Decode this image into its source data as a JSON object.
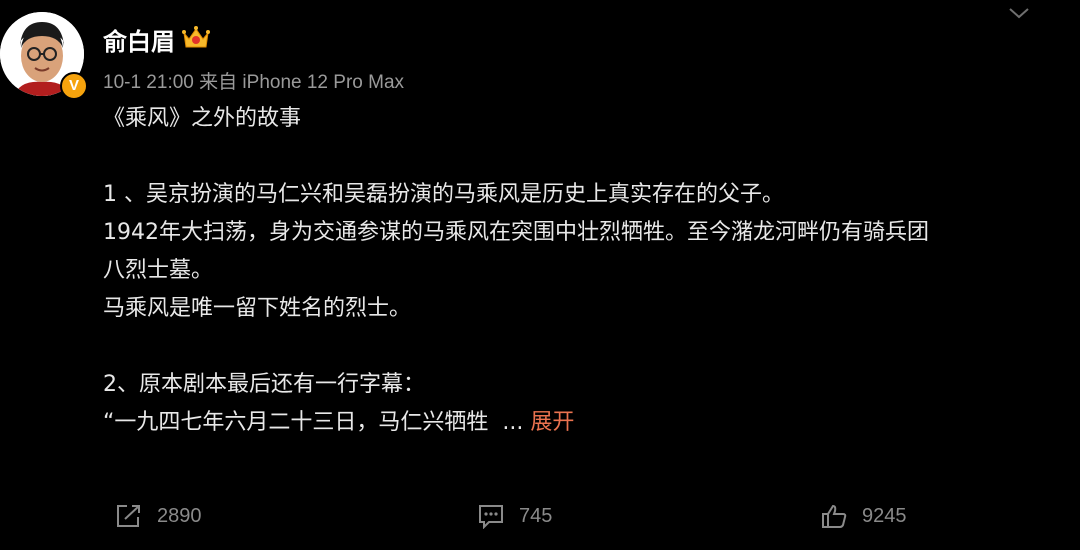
{
  "author": {
    "name": "俞白眉",
    "verified_badge": "V",
    "crown_icon": "crown-icon"
  },
  "meta": {
    "time": "10-1 21:00",
    "source": "来自 iPhone 12 Pro Max"
  },
  "post": {
    "line1": "《乘风》之外的故事",
    "line2": "1 、吴京扮演的马仁兴和吴磊扮演的马乘风是历史上真实存在的父子。",
    "line3": "1942年大扫荡，身为交通参谋的马乘风在突围中壮烈牺牲。至今潴龙河畔仍有骑兵团",
    "line4": "八烈士墓。",
    "line5": "马乘风是唯一留下姓名的烈士。",
    "line6": "2、原本剧本最后还有一行字幕：",
    "line7": "“一九四七年六月二十三日，马仁兴牺牲  ...",
    "expand": "展开"
  },
  "actions": {
    "repost_count": "2890",
    "comment_count": "745",
    "like_count": "9245"
  },
  "colors": {
    "background": "#000000",
    "accent": "#eb7350",
    "badge": "#f6a30d",
    "muted": "#8a8a8a"
  }
}
